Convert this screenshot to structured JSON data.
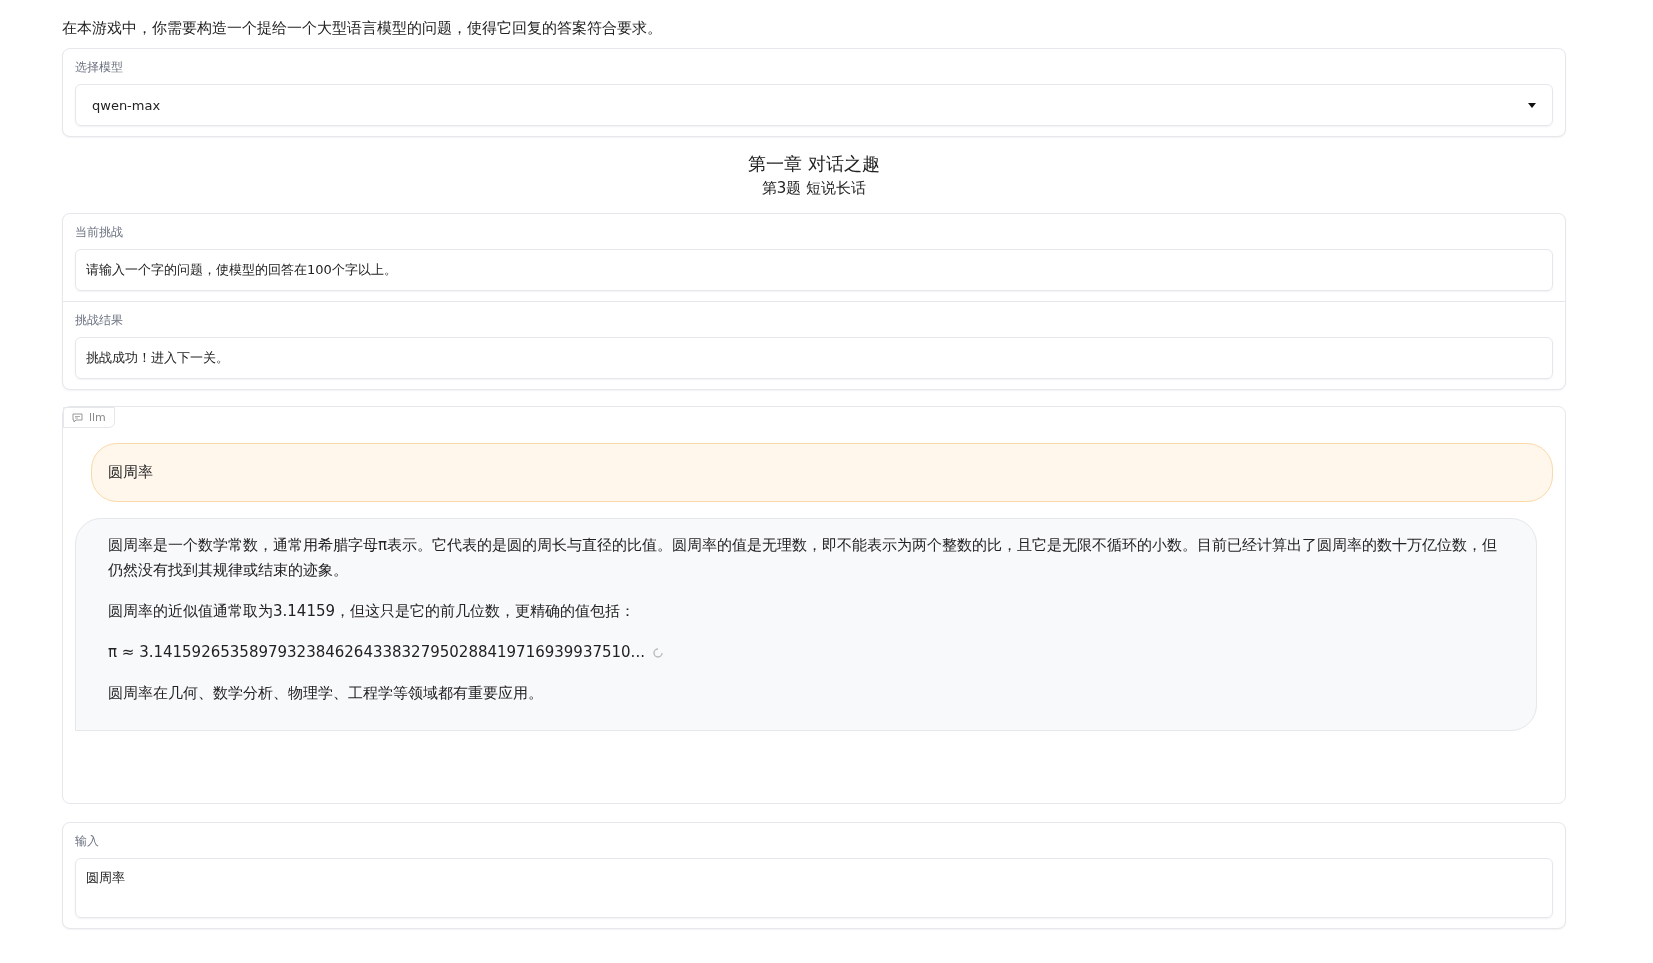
{
  "intro": "在本游戏中，你需要构造一个提给一个大型语言模型的问题，使得它回复的答案符合要求。",
  "model_select": {
    "label": "选择模型",
    "value": "qwen-max"
  },
  "chapter": {
    "title": "第一章 对话之趣",
    "subtitle": "第3题 短说长话"
  },
  "challenge": {
    "label": "当前挑战",
    "value": "请输入一个字的问题，使模型的回答在100个字以上。"
  },
  "result": {
    "label": "挑战结果",
    "value": "挑战成功！进入下一关。"
  },
  "chat": {
    "label": "llm",
    "messages": [
      {
        "kind": "user",
        "paragraphs": [
          {
            "text": "圆周率",
            "loading": false
          }
        ]
      },
      {
        "kind": "bot",
        "paragraphs": [
          {
            "text": "圆周率是一个数学常数，通常用希腊字母π表示。它代表的是圆的周长与直径的比值。圆周率的值是无理数，即不能表示为两个整数的比，且它是无限不循环的小数。目前已经计算出了圆周率的数十万亿位数，但仍然没有找到其规律或结束的迹象。",
            "loading": false
          },
          {
            "text": "圆周率的近似值通常取为3.14159，但这只是它的前几位数，更精确的值包括：",
            "loading": false
          },
          {
            "text": "π ≈ 3.14159265358979323846264338327950288419716939937510...",
            "loading": true
          },
          {
            "text": "圆周率在几何、数学分析、物理学、工程学等领域都有重要应用。",
            "loading": false
          }
        ]
      }
    ]
  },
  "input": {
    "label": "输入",
    "value": "圆周率"
  }
}
